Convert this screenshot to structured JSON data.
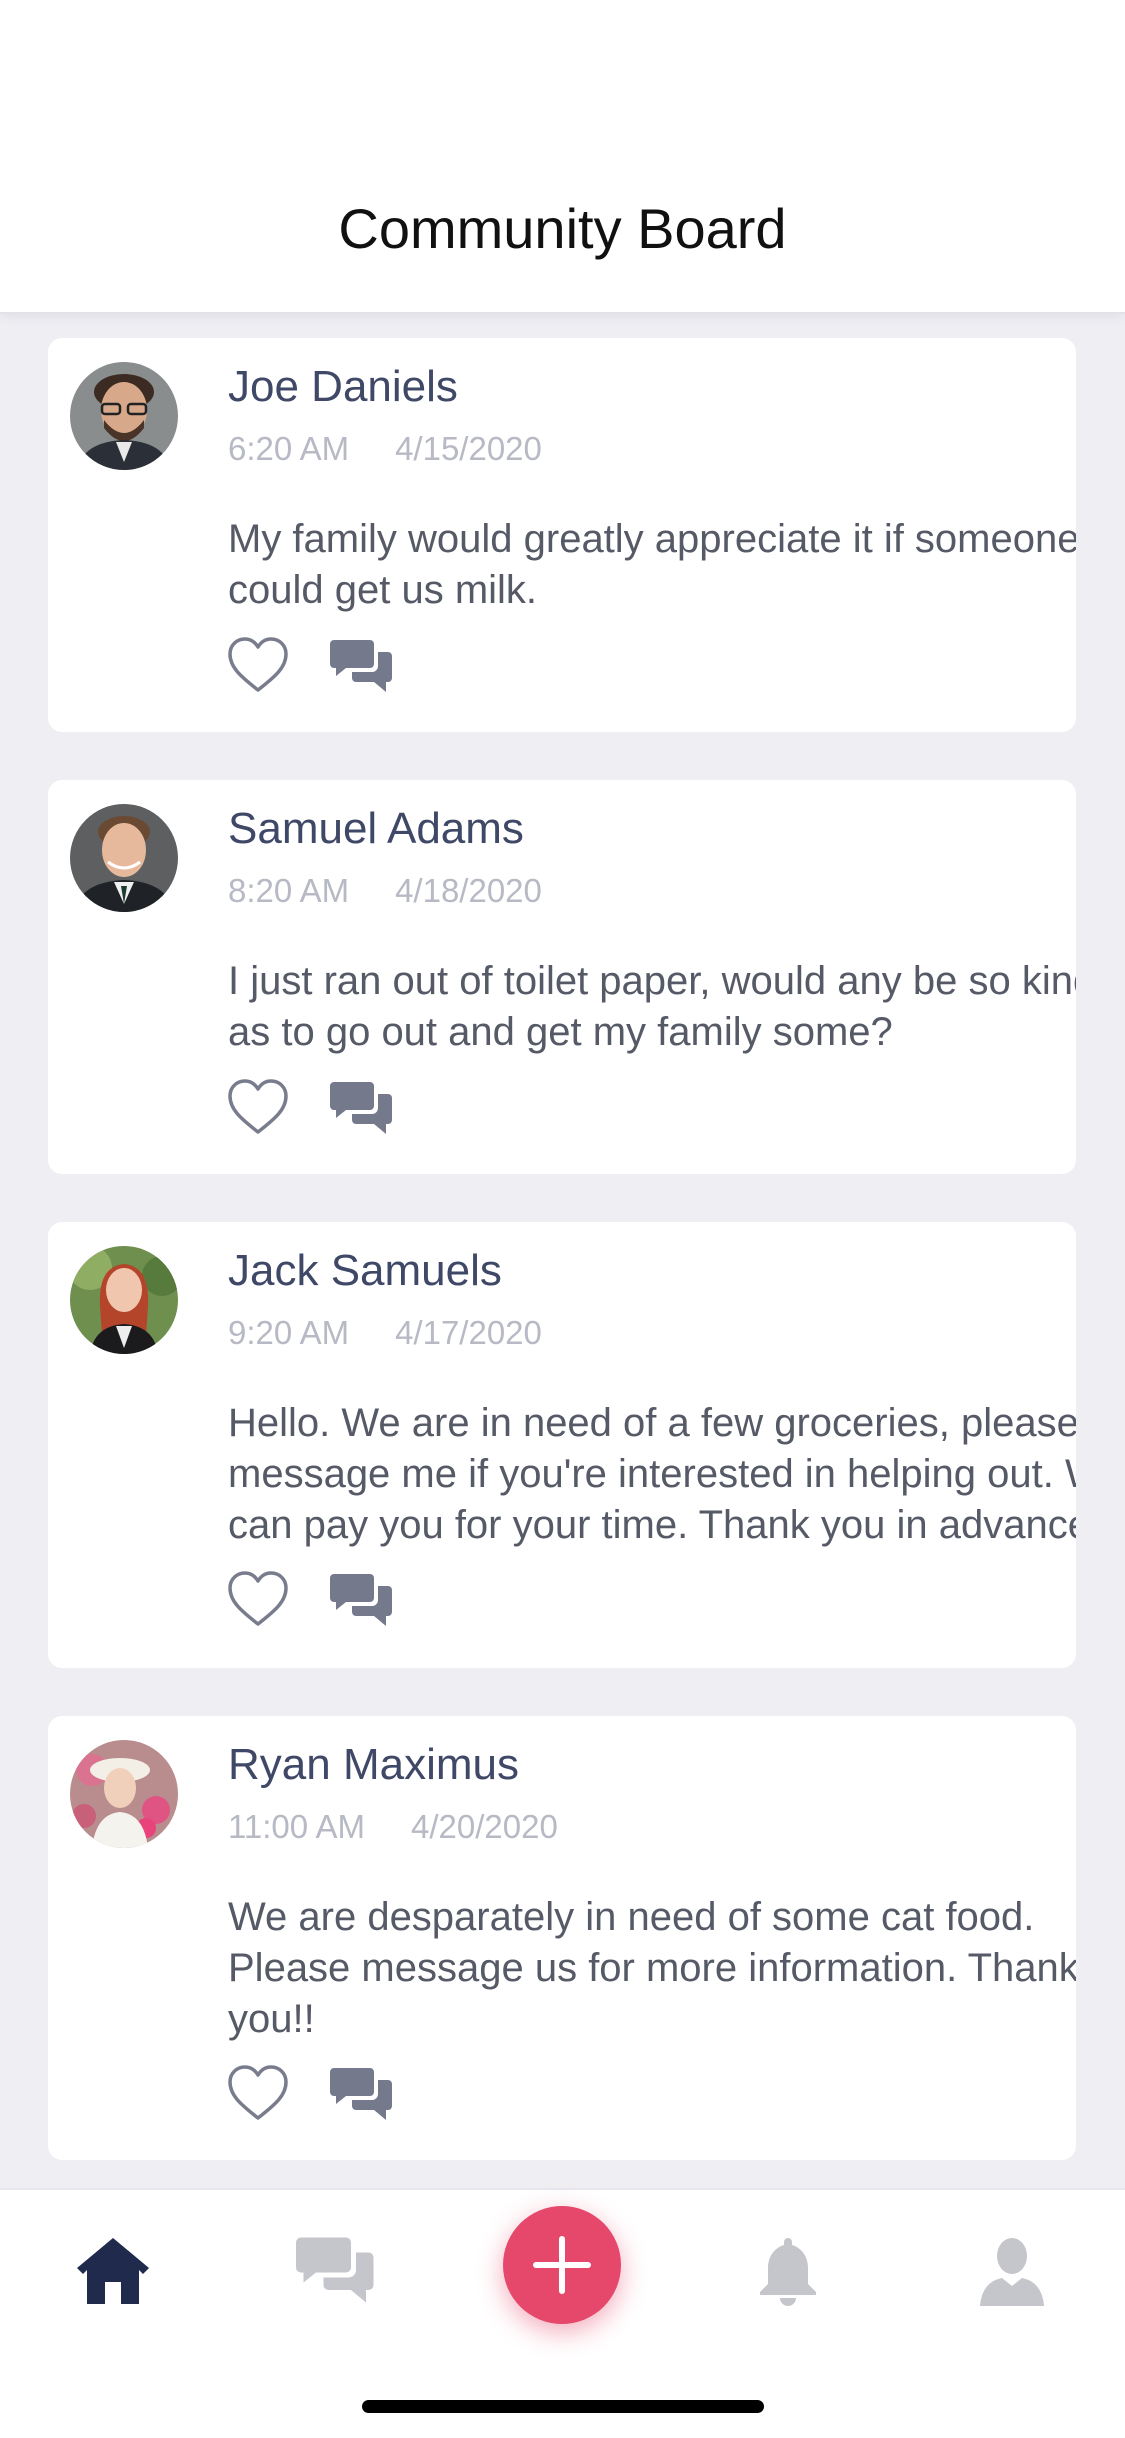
{
  "header": {
    "title": "Community Board"
  },
  "posts": [
    {
      "name": "Joe Daniels",
      "time": "6:20 AM",
      "date": "4/15/2020",
      "text": "My family would greatly appreciate it if someone\ncould get us milk."
    },
    {
      "name": "Samuel Adams",
      "time": "8:20 AM",
      "date": "4/18/2020",
      "text": "I just ran out of toilet paper, would any be so kind\nas to go out and get my family some?"
    },
    {
      "name": "Jack Samuels",
      "time": "9:20 AM",
      "date": "4/17/2020",
      "text": "Hello. We are in need of a few groceries, please\nmessage me if you're interested in helping out. We\ncan pay you for your time. Thank you in advance!"
    },
    {
      "name": "Ryan Maximus",
      "time": "11:00 AM",
      "date": "4/20/2020",
      "text": "We are desparately in need of some cat food.\nPlease message us for more information. Thank\nyou!!"
    }
  ],
  "icons": {
    "like": "heart-outline-icon",
    "comment": "chat-bubbles-icon",
    "home": "home-icon",
    "messages": "chat-bubbles-icon",
    "add": "plus-icon",
    "notifications": "bell-icon",
    "profile": "person-icon"
  },
  "colors": {
    "accent": "#e5486a",
    "name_text": "#3f4867",
    "meta_text": "#b7b9c4",
    "active_tab": "#1f2a4d",
    "inactive_tab": "#c5c5cc",
    "background": "#efeef3"
  }
}
